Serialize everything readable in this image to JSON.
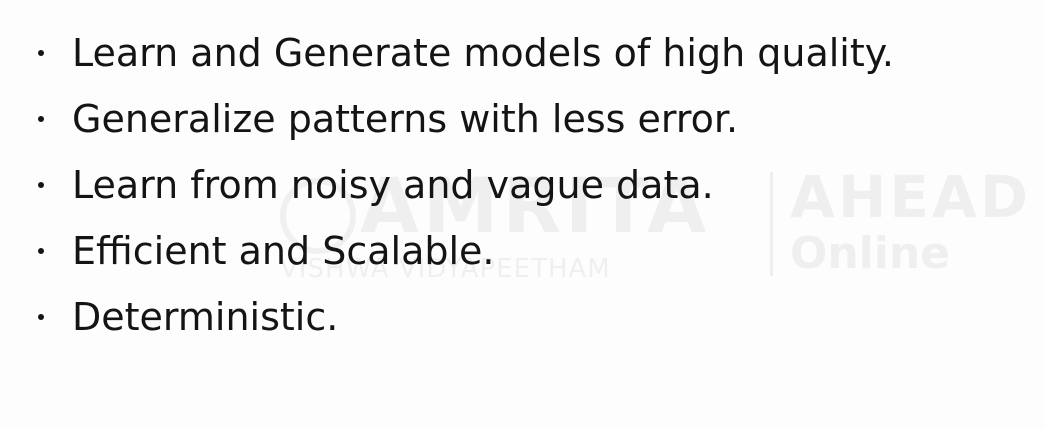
{
  "bullets": [
    "Learn and Generate models of high quality.",
    "Generalize patterns with less error.",
    "Learn from noisy and vague data.",
    "Efficient and Scalable.",
    "Deterministic."
  ],
  "watermark": {
    "brand": "AMRITA",
    "subtitle": "VISHWA VIDYAPEETHAM",
    "partner_top": "AHEAD",
    "partner_bottom": "Online"
  }
}
